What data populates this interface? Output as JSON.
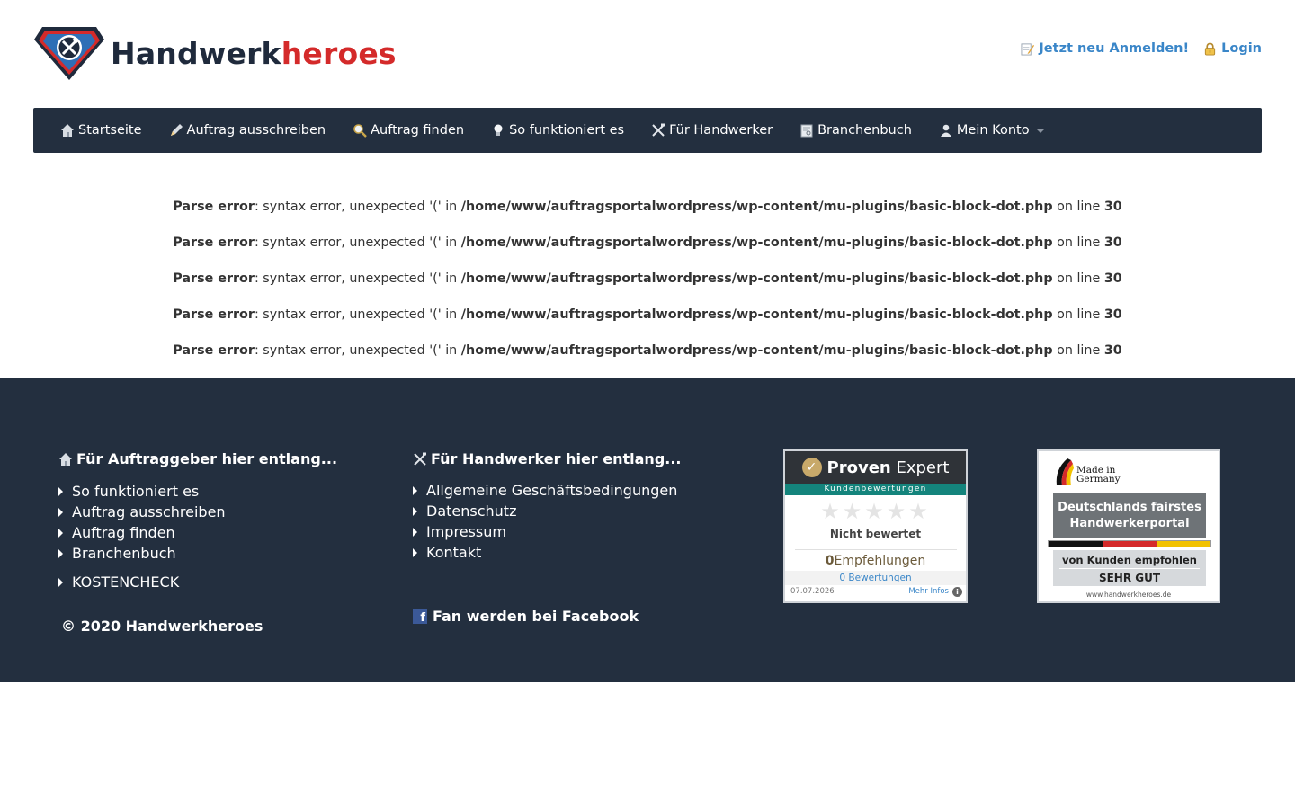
{
  "brand": {
    "name_part1": "Handwerk",
    "name_part2": "heroes",
    "logo_icon": "shield-tools-icon"
  },
  "top_links": [
    {
      "label": "Jetzt neu Anmelden!",
      "icon": "note-pencil-icon"
    },
    {
      "label": "Login",
      "icon": "padlock-icon"
    }
  ],
  "nav": {
    "items": [
      {
        "label": "Startseite",
        "icon": "house-icon"
      },
      {
        "label": "Auftrag ausschreiben",
        "icon": "pencil-icon"
      },
      {
        "label": "Auftrag finden",
        "icon": "magnifier-icon"
      },
      {
        "label": "So funktioniert es",
        "icon": "lightbulb-icon"
      },
      {
        "label": "Für Handwerker",
        "icon": "tools-icon"
      },
      {
        "label": "Branchenbuch",
        "icon": "book-icon"
      },
      {
        "label": "Mein Konto",
        "icon": "user-icon"
      }
    ]
  },
  "errors": {
    "label": "Parse error",
    "message": ": syntax error, unexpected '(' in ",
    "path": "/home/www/auftragsportalwordpress/wp-content/mu-plugins/basic-block-dot.php",
    "on_line": " on line ",
    "line": "30",
    "count": 5
  },
  "footer": {
    "col1": {
      "title": "Für Auftraggeber hier entlang...",
      "links": [
        "So funktioniert es",
        "Auftrag ausschreiben",
        "Auftrag finden",
        "Branchenbuch"
      ],
      "extra_link": "KOSTENCHECK",
      "copyright": "© 2020 Handwerkheroes"
    },
    "col2": {
      "title": "Für Handwerker hier entlang...",
      "links": [
        "Allgemeine Geschäftsbedingungen",
        "Datenschutz",
        "Impressum",
        "Kontakt"
      ],
      "facebook": "Fan werden bei Facebook"
    },
    "proven_expert": {
      "brand_bold": "Proven",
      "brand_light": " Expert",
      "subtitle": "Kundenbewertungen",
      "status": "Nicht bewertet",
      "recommendations_count": "0",
      "recommendations_label": "Empfehlungen",
      "reviews": "0 Bewertungen",
      "date": "07.07.2026",
      "more": "Mehr Infos",
      "stars": 0
    },
    "germany_badge": {
      "made_in_1": "Made in",
      "made_in_2": "Germany",
      "line1": "Deutschlands fairstes",
      "line2": "Handwerkerportal",
      "recommended": "von Kunden empfohlen",
      "rating": "SEHR GUT",
      "url": "www.handwerkheroes.de"
    }
  },
  "colors": {
    "nav_bg": "#232f3f",
    "brand_red": "#d42a2a",
    "link_blue": "#3a86c8"
  }
}
